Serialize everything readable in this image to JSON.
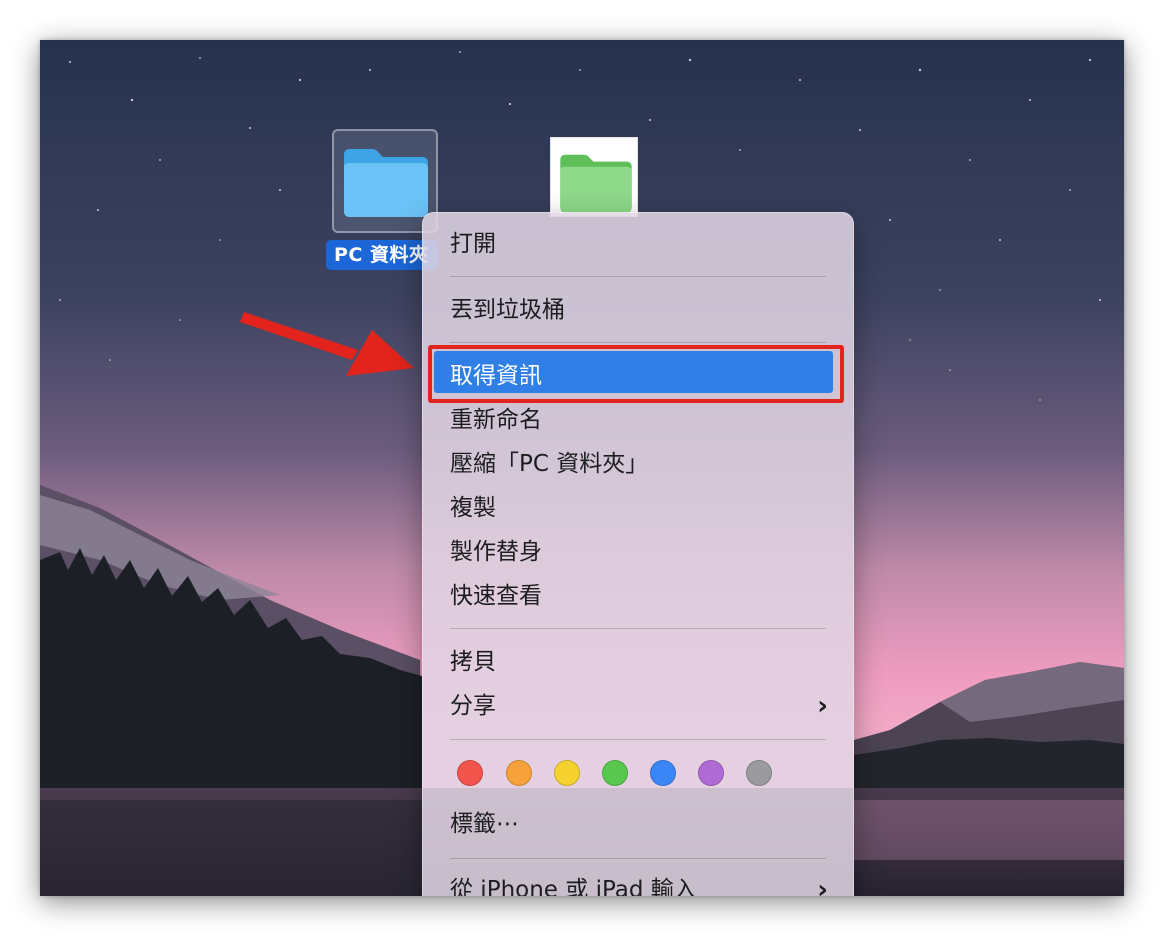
{
  "desktop": {
    "selected_folder_label": "PC 資料夾",
    "folder_icon_colors": {
      "pc_folder": "#6cc3f7",
      "green_folder": "#8ed98a"
    },
    "accent": "#1b67d8",
    "annotation_color": "#e2241c"
  },
  "context_menu": {
    "open": "打開",
    "move_to_trash": "丟到垃圾桶",
    "get_info": "取得資訊",
    "rename": "重新命名",
    "compress": "壓縮「PC 資料夾」",
    "duplicate": "複製",
    "make_alias": "製作替身",
    "quick_look": "快速查看",
    "copy": "拷貝",
    "share": "分享",
    "tags": "標籤⋯",
    "import_from_iphone": "從 iPhone 或 iPad 輸入",
    "tag_colors": [
      {
        "name": "red",
        "hex": "#f2544c"
      },
      {
        "name": "orange",
        "hex": "#f6a13a"
      },
      {
        "name": "yellow",
        "hex": "#f5d130"
      },
      {
        "name": "green",
        "hex": "#57c84d"
      },
      {
        "name": "blue",
        "hex": "#3b86f6"
      },
      {
        "name": "purple",
        "hex": "#b06ad6"
      },
      {
        "name": "gray",
        "hex": "#9b9b9d"
      }
    ],
    "highlighted_item": "取得資訊",
    "highlight_color": "#2f7fe7"
  }
}
